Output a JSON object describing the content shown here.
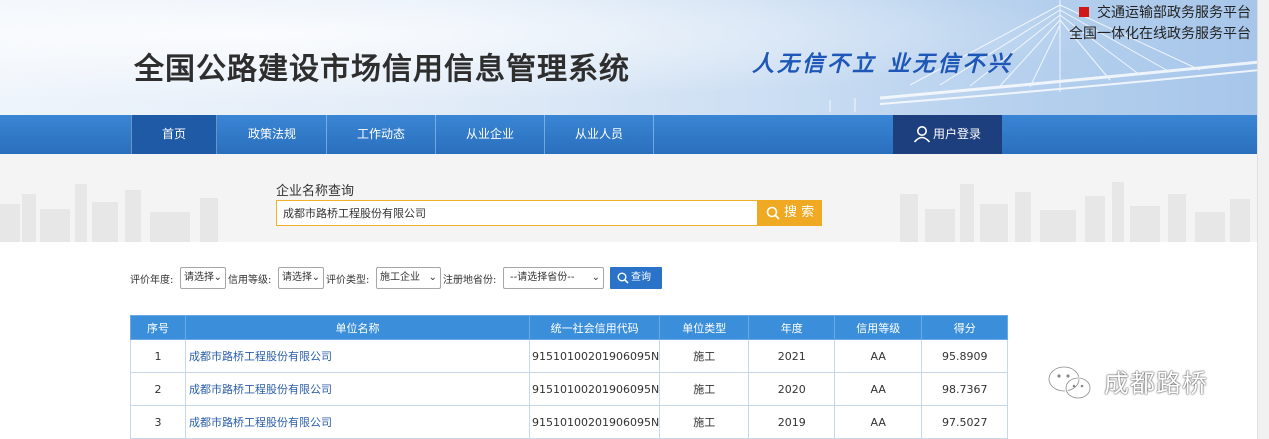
{
  "header": {
    "top_links": [
      "交通运输部政务服务平台",
      "全国一体化在线政务服务平台"
    ],
    "site_title": "全国公路建设市场信用信息管理系统",
    "slogan": "人无信不立 业无信不兴"
  },
  "nav": {
    "items": [
      {
        "label": "首页",
        "active": true
      },
      {
        "label": "政策法规",
        "active": false
      },
      {
        "label": "工作动态",
        "active": false
      },
      {
        "label": "从业企业",
        "active": false
      },
      {
        "label": "从业人员",
        "active": false
      }
    ],
    "login_label": "用户登录"
  },
  "search": {
    "label": "企业名称查询",
    "value": "成都市路桥工程股份有限公司",
    "button_label": "搜 索"
  },
  "filters": {
    "year_label": "评价年度:",
    "year_value": "请选择",
    "grade_label": "信用等级:",
    "grade_value": "请选择",
    "type_label": "评价类型:",
    "type_value": "施工企业",
    "province_label": "注册地省份:",
    "province_value": "--请选择省份--",
    "query_label": "查询"
  },
  "table": {
    "headers": [
      "序号",
      "单位名称",
      "统一社会信用代码",
      "单位类型",
      "年度",
      "信用等级",
      "得分"
    ],
    "rows": [
      [
        "1",
        "成都市路桥工程股份有限公司",
        "91510100201906095N",
        "施工",
        "2021",
        "AA",
        "95.8909"
      ],
      [
        "2",
        "成都市路桥工程股份有限公司",
        "91510100201906095N",
        "施工",
        "2020",
        "AA",
        "98.7367"
      ],
      [
        "3",
        "成都市路桥工程股份有限公司",
        "91510100201906095N",
        "施工",
        "2019",
        "AA",
        "97.5027"
      ]
    ]
  },
  "watermark": "成都路桥",
  "colors": {
    "nav_blue": "#2f7bc9",
    "login_bg": "#1e3f7e",
    "search_orange": "#f0a922",
    "table_header": "#3b8fda",
    "link_blue": "#2a5ea8",
    "slogan_blue": "#1f57b8"
  }
}
